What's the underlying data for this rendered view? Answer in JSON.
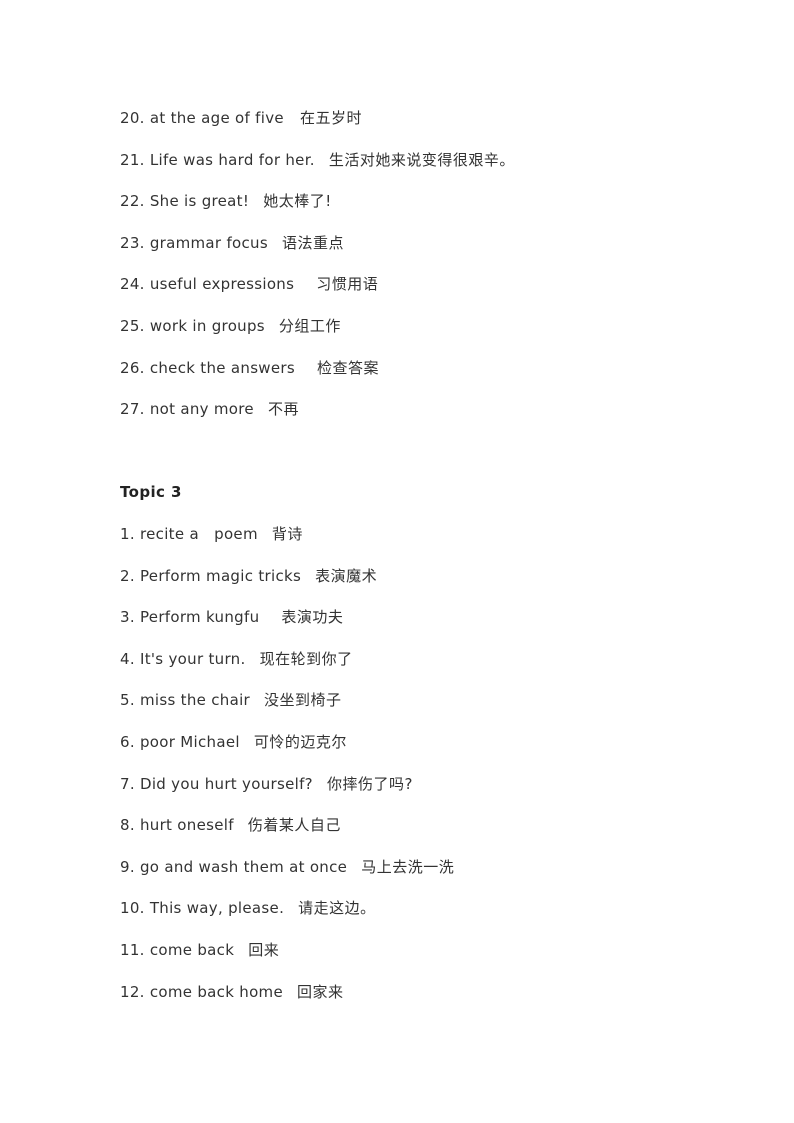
{
  "section_prev": {
    "items": [
      {
        "en": "20. at the age of five",
        "zh": "在五岁时"
      },
      {
        "en": "21. Life was hard for her.",
        "zh": "生活对她来说变得很艰辛。"
      },
      {
        "en": "22. She is great!",
        "zh": "她太棒了!"
      },
      {
        "en": "23. grammar focus",
        "zh": "语法重点"
      },
      {
        "en": "24. useful expressions",
        "zh": "习惯用语"
      },
      {
        "en": "25. work in groups",
        "zh": "分组工作"
      },
      {
        "en": "26. check the answers",
        "zh": "检查答案"
      },
      {
        "en": "27. not any more",
        "zh": "不再"
      }
    ]
  },
  "topic3": {
    "heading": "Topic 3",
    "items": [
      {
        "en": "1. recite a   poem",
        "zh": "背诗"
      },
      {
        "en": "2. Perform magic tricks",
        "zh": "表演魔术"
      },
      {
        "en": "3. Perform kungfu",
        "zh": "表演功夫"
      },
      {
        "en": "4. It's your turn.",
        "zh": "现在轮到你了"
      },
      {
        "en": "5. miss the chair",
        "zh": "没坐到椅子"
      },
      {
        "en": "6. poor Michael",
        "zh": "可怜的迈克尔"
      },
      {
        "en": "7. Did you hurt yourself?",
        "zh": "你摔伤了吗?"
      },
      {
        "en": "8. hurt oneself",
        "zh": "伤着某人自己"
      },
      {
        "en": "9. go and wash them at once",
        "zh": "马上去洗一洗"
      },
      {
        "en": "10. This way, please.",
        "zh": "请走这边。"
      },
      {
        "en": "11. come back",
        "zh": "回来"
      },
      {
        "en": "12. come back home",
        "zh": "回家来"
      }
    ]
  }
}
